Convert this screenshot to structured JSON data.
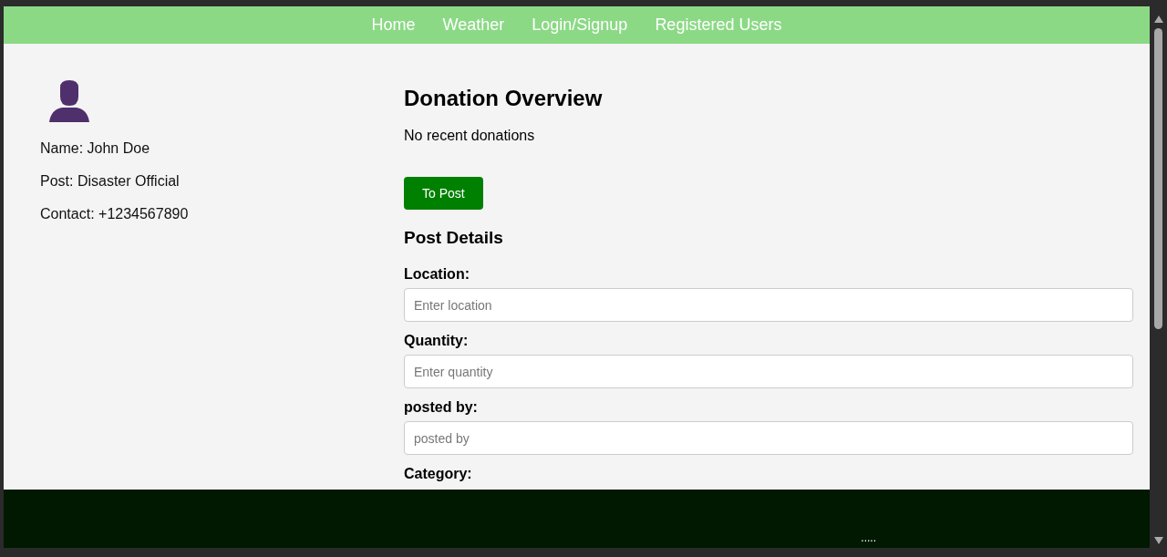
{
  "nav": {
    "links": [
      "Home",
      "Weather",
      "Login/Signup",
      "Registered Users"
    ]
  },
  "profile": {
    "lines": [
      "Name: John Doe",
      "Post: Disaster Official",
      "Contact: +1234567890"
    ]
  },
  "overview": {
    "title": "Donation Overview",
    "message": "No recent donations",
    "button": "To Post"
  },
  "form": {
    "title": "Post Details",
    "fields": [
      {
        "label": "Location:",
        "placeholder": "Enter location"
      },
      {
        "label": "Quantity:",
        "placeholder": "Enter quantity"
      },
      {
        "label": "posted by:",
        "placeholder": "posted by"
      },
      {
        "label": "Category:"
      }
    ]
  },
  "footer": {
    "text": "....."
  }
}
